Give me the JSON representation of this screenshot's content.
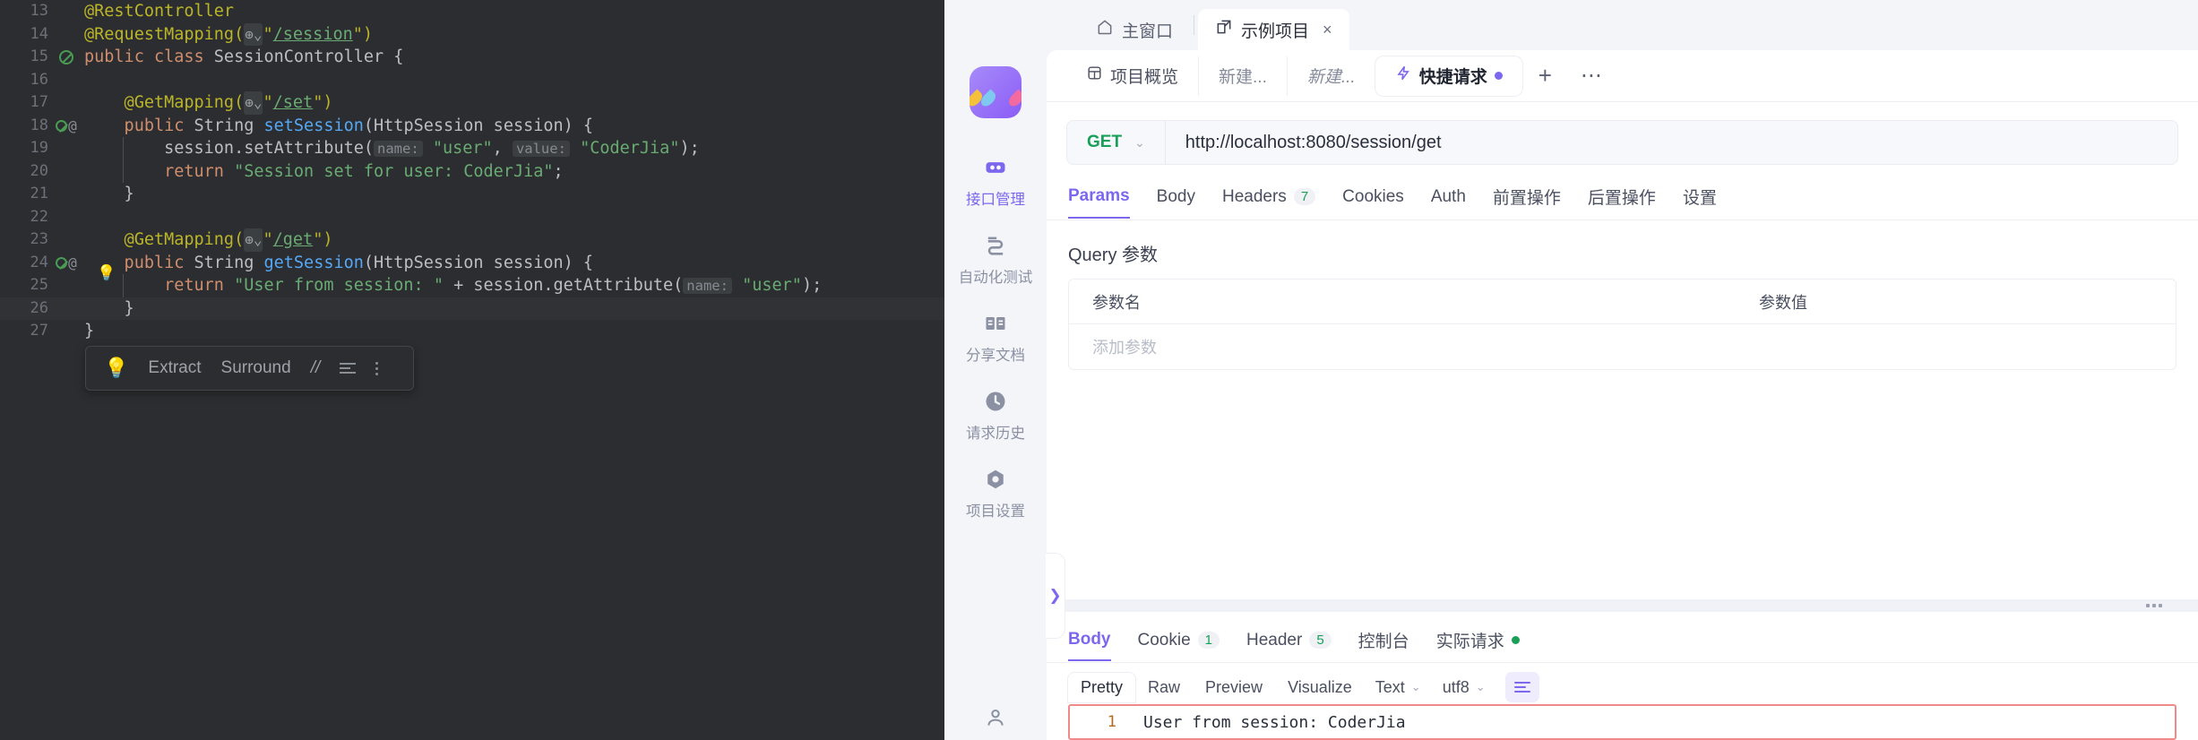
{
  "ide": {
    "lines": [
      {
        "n": "13",
        "mark": "",
        "tokens": [
          {
            "t": "ann",
            "v": "@RestController"
          }
        ],
        "indent": 0
      },
      {
        "n": "14",
        "mark": "",
        "tokens": [
          {
            "t": "ann",
            "v": "@RequestMapping("
          },
          {
            "t": "globe",
            "v": "⊕⌄"
          },
          {
            "t": "ann",
            "v": "\""
          },
          {
            "t": "url",
            "v": "/session"
          },
          {
            "t": "ann",
            "v": "\")"
          }
        ],
        "indent": 0
      },
      {
        "n": "15",
        "mark": "green",
        "tokens": [
          {
            "t": "kw",
            "v": "public class "
          },
          {
            "t": "plain",
            "v": "SessionController {"
          }
        ],
        "indent": 0
      },
      {
        "n": "16",
        "mark": "",
        "tokens": [],
        "indent": 0
      },
      {
        "n": "17",
        "mark": "",
        "tokens": [
          {
            "t": "ann",
            "v": "    @GetMapping("
          },
          {
            "t": "globe",
            "v": "⊕⌄"
          },
          {
            "t": "ann",
            "v": "\""
          },
          {
            "t": "url",
            "v": "/set"
          },
          {
            "t": "ann",
            "v": "\")"
          }
        ],
        "indent": 0
      },
      {
        "n": "18",
        "mark": "green-at",
        "tokens": [
          {
            "t": "kw",
            "v": "    public "
          },
          {
            "t": "plain",
            "v": "String "
          },
          {
            "t": "fn",
            "v": "setSession"
          },
          {
            "t": "plain",
            "v": "(HttpSession session) {"
          }
        ],
        "indent": 0
      },
      {
        "n": "19",
        "mark": "",
        "tokens": [
          {
            "t": "plain",
            "v": "        session.setAttribute("
          },
          {
            "t": "hint",
            "v": "name:"
          },
          {
            "t": "str",
            "v": " \"user\""
          },
          {
            "t": "plain",
            "v": ", "
          },
          {
            "t": "hint",
            "v": "value:"
          },
          {
            "t": "str",
            "v": " \"CoderJia\""
          },
          {
            "t": "plain",
            "v": ");"
          }
        ],
        "indent": 1
      },
      {
        "n": "20",
        "mark": "",
        "tokens": [
          {
            "t": "kw",
            "v": "        return "
          },
          {
            "t": "str",
            "v": "\"Session set for user: CoderJia\""
          },
          {
            "t": "plain",
            "v": ";"
          }
        ],
        "indent": 1
      },
      {
        "n": "21",
        "mark": "",
        "tokens": [
          {
            "t": "plain",
            "v": "    }"
          }
        ],
        "indent": 0
      },
      {
        "n": "22",
        "mark": "",
        "tokens": [],
        "indent": 0
      },
      {
        "n": "23",
        "mark": "",
        "tokens": [
          {
            "t": "ann",
            "v": "    @GetMapping("
          },
          {
            "t": "globe",
            "v": "⊕⌄"
          },
          {
            "t": "ann",
            "v": "\""
          },
          {
            "t": "url",
            "v": "/get"
          },
          {
            "t": "ann",
            "v": "\")"
          }
        ],
        "indent": 0
      },
      {
        "n": "24",
        "mark": "green-at-bulb",
        "tokens": [
          {
            "t": "kw",
            "v": "    public "
          },
          {
            "t": "plain",
            "v": "String "
          },
          {
            "t": "fn",
            "v": "getSession"
          },
          {
            "t": "plain",
            "v": "(HttpSession session) {"
          }
        ],
        "indent": 0
      },
      {
        "n": "25",
        "mark": "",
        "tokens": [
          {
            "t": "kw",
            "v": "        return "
          },
          {
            "t": "str",
            "v": "\"User from session: \""
          },
          {
            "t": "plain",
            "v": " + session.getAttribute("
          },
          {
            "t": "hint",
            "v": "name:"
          },
          {
            "t": "str",
            "v": " \"user\""
          },
          {
            "t": "plain",
            "v": ");"
          }
        ],
        "indent": 1
      },
      {
        "n": "26",
        "mark": "",
        "tokens": [
          {
            "t": "plain",
            "v": "    }"
          }
        ],
        "indent": 0,
        "highlight": true
      },
      {
        "n": "27",
        "mark": "",
        "tokens": [
          {
            "t": "plain",
            "v": "}"
          }
        ],
        "indent": 0
      }
    ],
    "intention_popup": {
      "bulb": "bulb-icon",
      "extract_label": "Extract",
      "surround_label": "Surround",
      "comment_label": "//",
      "indent_icon": "indent-icon",
      "more_icon": "more-vertical-icon"
    }
  },
  "window_tabs": {
    "home": {
      "label": "主窗口",
      "icon": "home-icon"
    },
    "project": {
      "label": "示例项目",
      "icon": "external-link-icon",
      "close": "×"
    }
  },
  "rail": {
    "logo": "apifox-logo",
    "items": [
      {
        "label": "接口管理",
        "icon": "api-icon",
        "active": true
      },
      {
        "label": "自动化测试",
        "icon": "test-flow-icon",
        "active": false
      },
      {
        "label": "分享文档",
        "icon": "book-icon",
        "active": false
      },
      {
        "label": "请求历史",
        "icon": "clock-icon",
        "active": false
      },
      {
        "label": "项目设置",
        "icon": "gear-hex-icon",
        "active": false
      }
    ],
    "user_icon": "user-icon"
  },
  "doc_tabs": [
    {
      "label": "项目概览",
      "icon": "overview-icon",
      "style": "plain",
      "active": false
    },
    {
      "label": "新建...",
      "icon": "",
      "style": "plain-dim",
      "active": false
    },
    {
      "label": "新建...",
      "icon": "",
      "style": "italic",
      "active": false
    },
    {
      "label": "快捷请求",
      "icon": "bolt-icon",
      "style": "plain",
      "active": true,
      "dot": true
    }
  ],
  "doc_tabs_controls": {
    "plus": "+",
    "more": "⋯"
  },
  "url_bar": {
    "method": "GET",
    "method_chevron": "⌄",
    "url": "http://localhost:8080/session/get"
  },
  "request_tabs": [
    {
      "label": "Params",
      "count": "",
      "active": true
    },
    {
      "label": "Body",
      "count": "",
      "active": false
    },
    {
      "label": "Headers",
      "count": "7",
      "active": false
    },
    {
      "label": "Cookies",
      "count": "",
      "active": false
    },
    {
      "label": "Auth",
      "count": "",
      "active": false
    },
    {
      "label": "前置操作",
      "count": "",
      "active": false
    },
    {
      "label": "后置操作",
      "count": "",
      "active": false
    },
    {
      "label": "设置",
      "count": "",
      "active": false
    }
  ],
  "query": {
    "title": "Query 参数",
    "col_name": "参数名",
    "col_value": "参数值",
    "add_placeholder": "添加参数"
  },
  "splitter": {
    "expand_icon": "chevron-right-icon",
    "grip_icon": "drag-grip-icon"
  },
  "response_tabs": [
    {
      "label": "Body",
      "count": "",
      "active": true,
      "dot": false
    },
    {
      "label": "Cookie",
      "count": "1",
      "active": false,
      "dot": false
    },
    {
      "label": "Header",
      "count": "5",
      "active": false,
      "dot": false
    },
    {
      "label": "控制台",
      "count": "",
      "active": false,
      "dot": false
    },
    {
      "label": "实际请求",
      "count": "",
      "active": false,
      "dot": true
    }
  ],
  "format_bar": {
    "items": [
      {
        "label": "Pretty",
        "active": true
      },
      {
        "label": "Raw",
        "active": false
      },
      {
        "label": "Preview",
        "active": false
      },
      {
        "label": "Visualize",
        "active": false
      }
    ],
    "type_select": "Text",
    "encoding_select": "utf8",
    "chevron": "⌄",
    "wrap_icon": "word-wrap-icon"
  },
  "response_body": {
    "line_number": "1",
    "text": "User from session: CoderJia"
  },
  "colors": {
    "accent": "#7c68ee",
    "method_green": "#18a058",
    "highlight_border": "#f08a8a",
    "ide_bg": "#2b2d30"
  }
}
